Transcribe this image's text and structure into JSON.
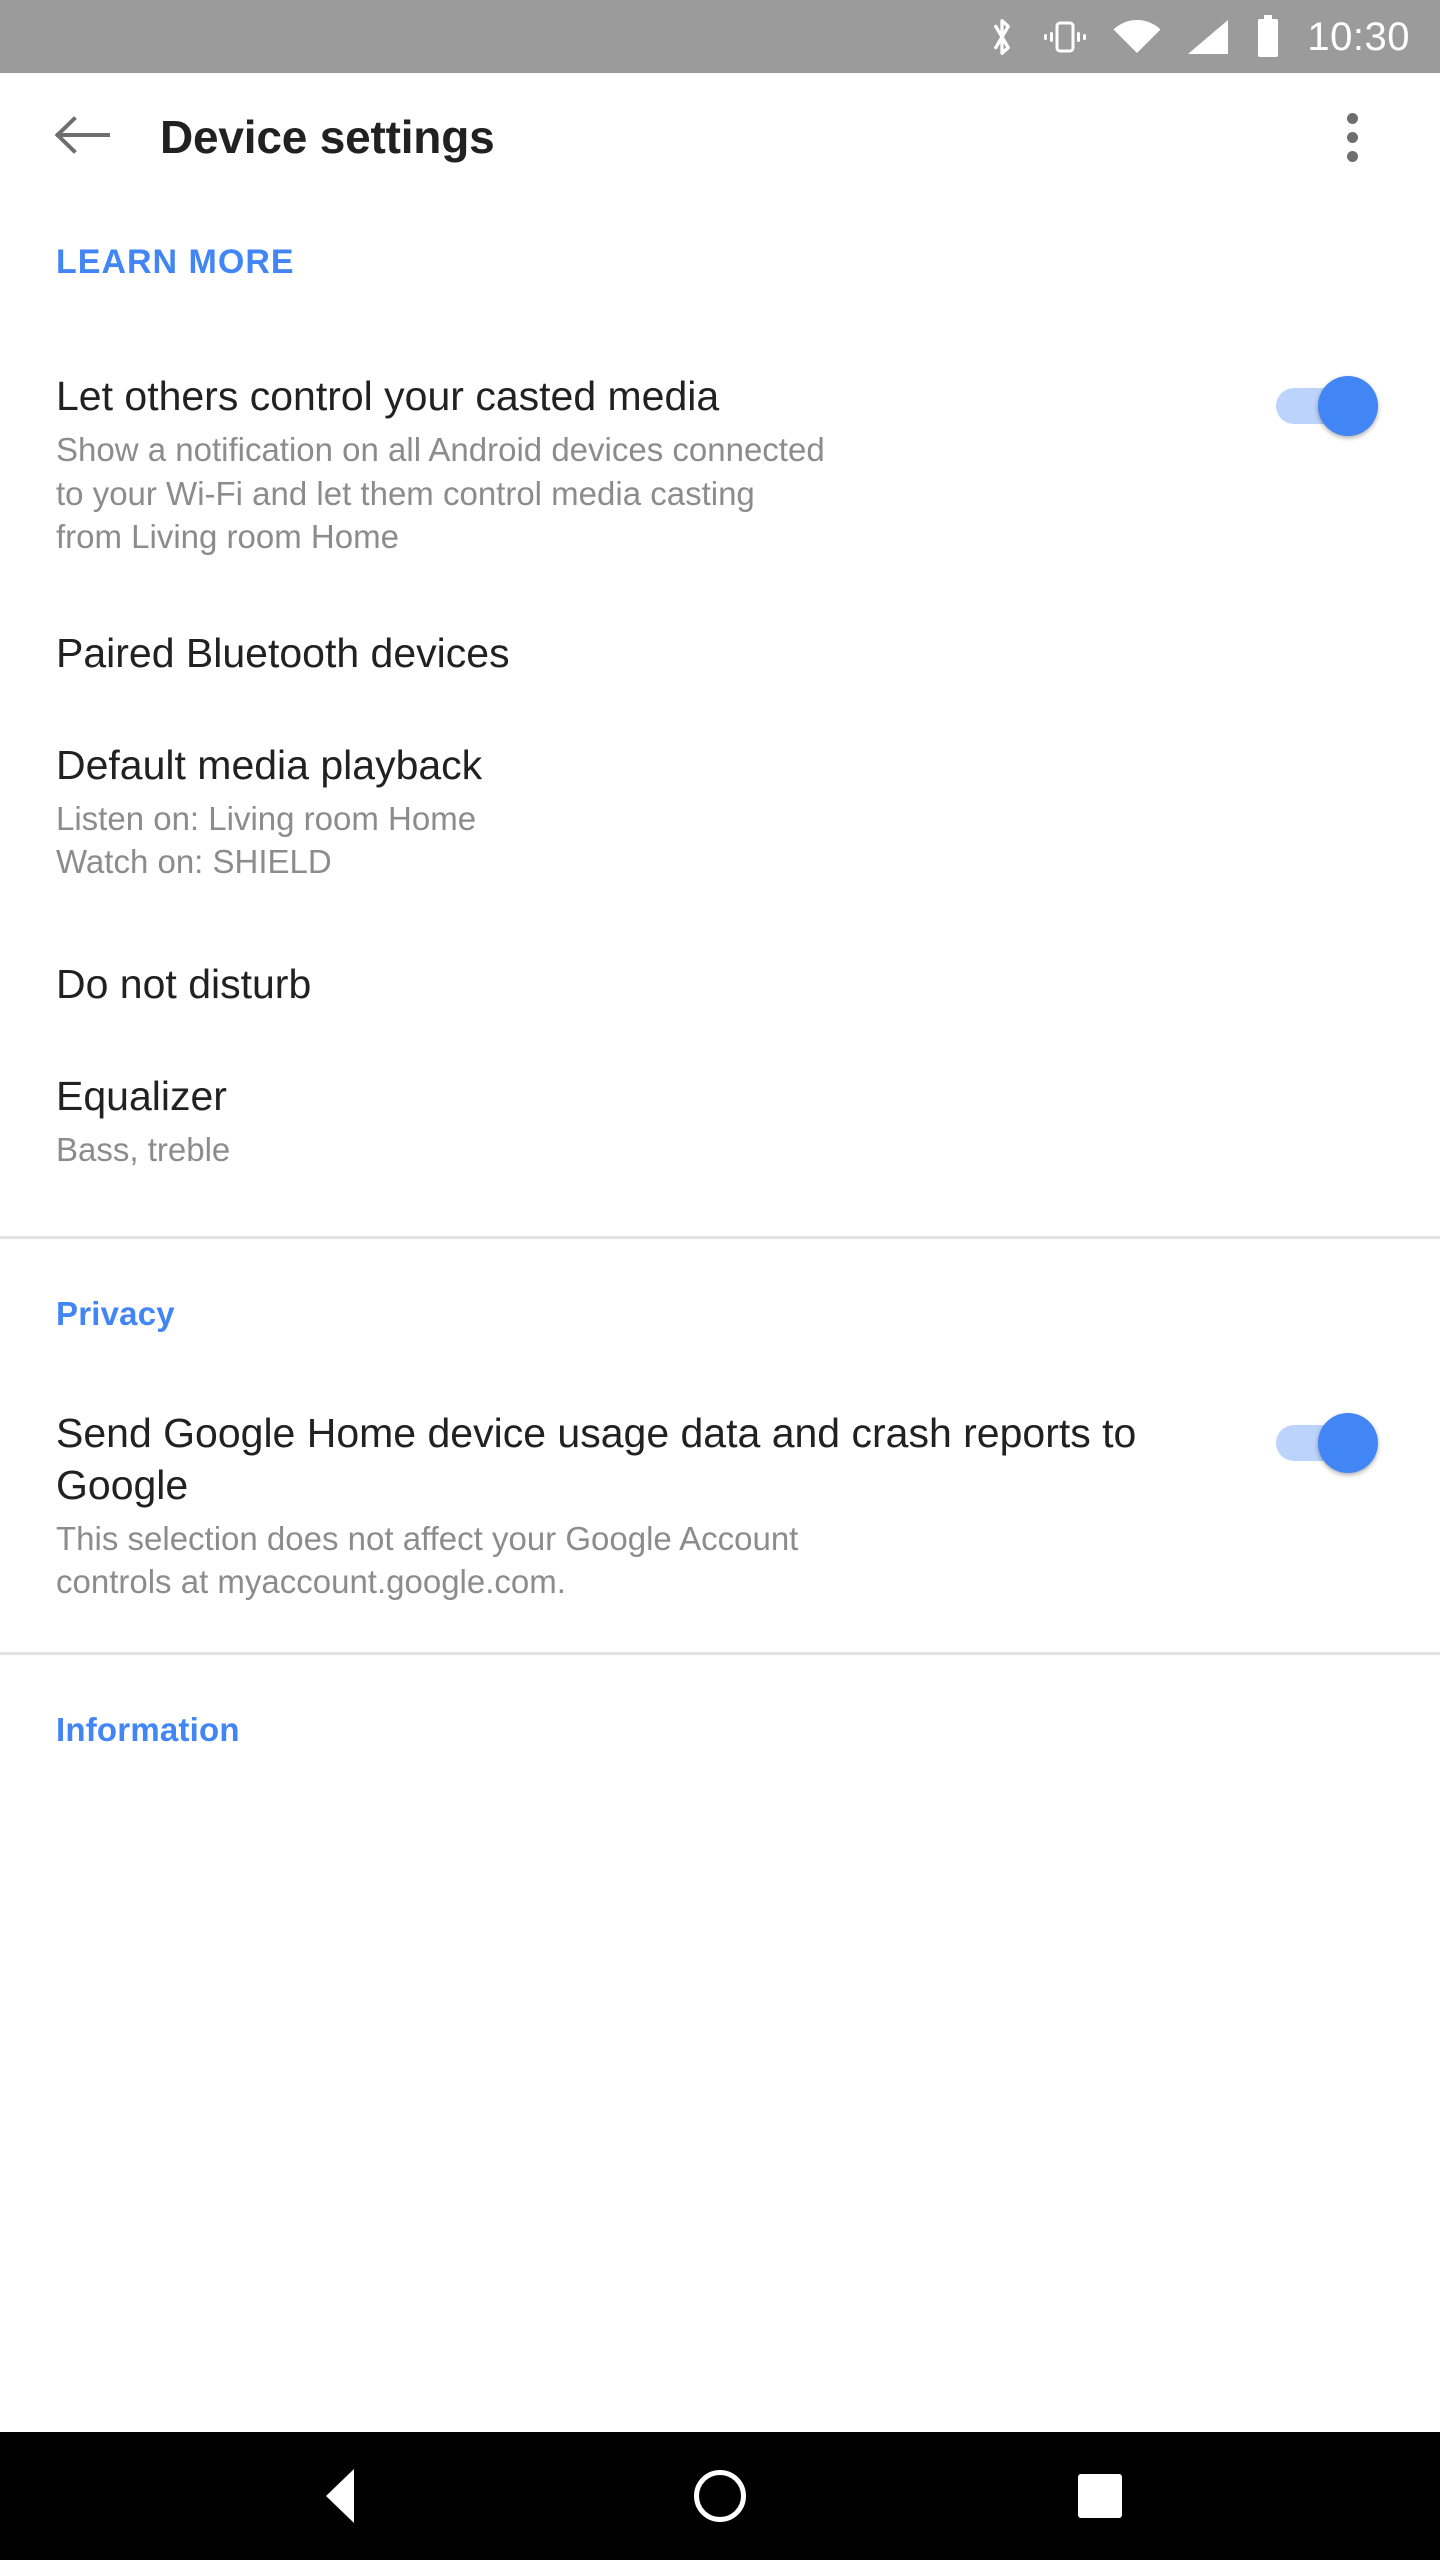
{
  "status_bar": {
    "background_color": "#9b9b9b",
    "clock": "10:30",
    "icons": [
      "bluetooth-icon",
      "vibrate-icon",
      "wifi-icon",
      "cell-signal-icon",
      "battery-icon"
    ]
  },
  "app_bar": {
    "back_label": "back-arrow",
    "title": "Device settings",
    "overflow_label": "more-options"
  },
  "accent_color": "#4285f4",
  "links": {
    "learn_more": "LEARN MORE"
  },
  "settings": [
    {
      "id": "cast-control",
      "title": "Let others control your casted media",
      "subtitle_lines": [
        "Show a notification on all Android devices connected",
        "to your Wi-Fi and let them control media casting",
        "from Living room Home"
      ],
      "toggle": true,
      "toggle_state": "on"
    },
    {
      "id": "paired-bluetooth",
      "title": "Paired Bluetooth devices",
      "subtitle_lines": [],
      "toggle": false
    },
    {
      "id": "default-media-playback",
      "title": "Default media playback",
      "subtitle_lines": [
        "Listen on: Living room Home",
        "Watch on: SHIELD"
      ],
      "toggle": false
    },
    {
      "id": "do-not-disturb",
      "title": "Do not disturb",
      "subtitle_lines": [],
      "toggle": false
    },
    {
      "id": "equalizer",
      "title": "Equalizer",
      "subtitle_lines": [
        "Bass, treble"
      ],
      "toggle": false
    }
  ],
  "privacy_section": {
    "header": "Privacy",
    "item": {
      "id": "usage-data",
      "title": "Send Google Home device usage data and crash reports to Google",
      "subtitle_lines": [
        "This selection does not affect your Google Account",
        "controls at myaccount.google.com."
      ],
      "toggle": true,
      "toggle_state": "on"
    }
  },
  "information_section": {
    "header": "Information"
  },
  "nav_bar": {
    "background_color": "#000000",
    "back": "back-nav-button",
    "home": "home-nav-button",
    "recents": "recents-nav-button"
  }
}
